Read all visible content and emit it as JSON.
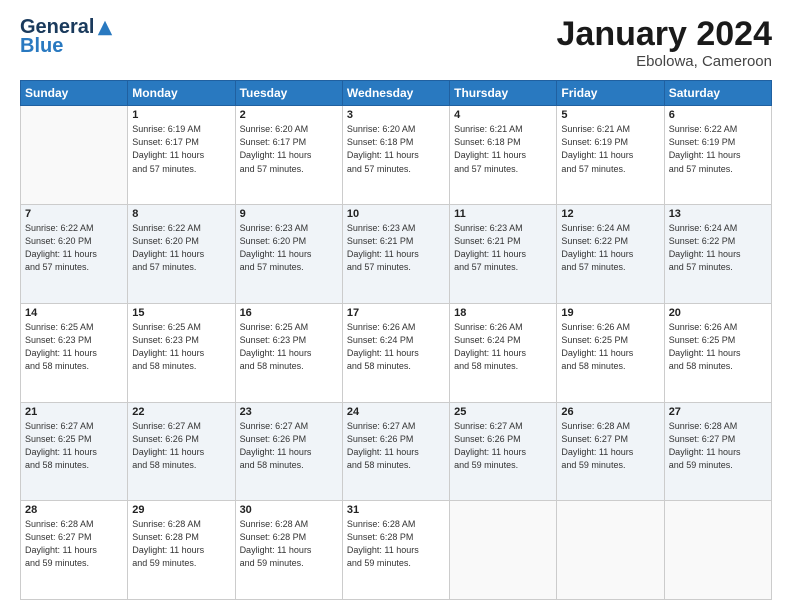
{
  "header": {
    "logo_general": "General",
    "logo_blue": "Blue",
    "month_title": "January 2024",
    "location": "Ebolowa, Cameroon"
  },
  "weekdays": [
    "Sunday",
    "Monday",
    "Tuesday",
    "Wednesday",
    "Thursday",
    "Friday",
    "Saturday"
  ],
  "weeks": [
    [
      {
        "day": "",
        "info": ""
      },
      {
        "day": "1",
        "info": "Sunrise: 6:19 AM\nSunset: 6:17 PM\nDaylight: 11 hours\nand 57 minutes."
      },
      {
        "day": "2",
        "info": "Sunrise: 6:20 AM\nSunset: 6:17 PM\nDaylight: 11 hours\nand 57 minutes."
      },
      {
        "day": "3",
        "info": "Sunrise: 6:20 AM\nSunset: 6:18 PM\nDaylight: 11 hours\nand 57 minutes."
      },
      {
        "day": "4",
        "info": "Sunrise: 6:21 AM\nSunset: 6:18 PM\nDaylight: 11 hours\nand 57 minutes."
      },
      {
        "day": "5",
        "info": "Sunrise: 6:21 AM\nSunset: 6:19 PM\nDaylight: 11 hours\nand 57 minutes."
      },
      {
        "day": "6",
        "info": "Sunrise: 6:22 AM\nSunset: 6:19 PM\nDaylight: 11 hours\nand 57 minutes."
      }
    ],
    [
      {
        "day": "7",
        "info": "Sunrise: 6:22 AM\nSunset: 6:20 PM\nDaylight: 11 hours\nand 57 minutes."
      },
      {
        "day": "8",
        "info": "Sunrise: 6:22 AM\nSunset: 6:20 PM\nDaylight: 11 hours\nand 57 minutes."
      },
      {
        "day": "9",
        "info": "Sunrise: 6:23 AM\nSunset: 6:20 PM\nDaylight: 11 hours\nand 57 minutes."
      },
      {
        "day": "10",
        "info": "Sunrise: 6:23 AM\nSunset: 6:21 PM\nDaylight: 11 hours\nand 57 minutes."
      },
      {
        "day": "11",
        "info": "Sunrise: 6:23 AM\nSunset: 6:21 PM\nDaylight: 11 hours\nand 57 minutes."
      },
      {
        "day": "12",
        "info": "Sunrise: 6:24 AM\nSunset: 6:22 PM\nDaylight: 11 hours\nand 57 minutes."
      },
      {
        "day": "13",
        "info": "Sunrise: 6:24 AM\nSunset: 6:22 PM\nDaylight: 11 hours\nand 57 minutes."
      }
    ],
    [
      {
        "day": "14",
        "info": "Sunrise: 6:25 AM\nSunset: 6:23 PM\nDaylight: 11 hours\nand 58 minutes."
      },
      {
        "day": "15",
        "info": "Sunrise: 6:25 AM\nSunset: 6:23 PM\nDaylight: 11 hours\nand 58 minutes."
      },
      {
        "day": "16",
        "info": "Sunrise: 6:25 AM\nSunset: 6:23 PM\nDaylight: 11 hours\nand 58 minutes."
      },
      {
        "day": "17",
        "info": "Sunrise: 6:26 AM\nSunset: 6:24 PM\nDaylight: 11 hours\nand 58 minutes."
      },
      {
        "day": "18",
        "info": "Sunrise: 6:26 AM\nSunset: 6:24 PM\nDaylight: 11 hours\nand 58 minutes."
      },
      {
        "day": "19",
        "info": "Sunrise: 6:26 AM\nSunset: 6:25 PM\nDaylight: 11 hours\nand 58 minutes."
      },
      {
        "day": "20",
        "info": "Sunrise: 6:26 AM\nSunset: 6:25 PM\nDaylight: 11 hours\nand 58 minutes."
      }
    ],
    [
      {
        "day": "21",
        "info": "Sunrise: 6:27 AM\nSunset: 6:25 PM\nDaylight: 11 hours\nand 58 minutes."
      },
      {
        "day": "22",
        "info": "Sunrise: 6:27 AM\nSunset: 6:26 PM\nDaylight: 11 hours\nand 58 minutes."
      },
      {
        "day": "23",
        "info": "Sunrise: 6:27 AM\nSunset: 6:26 PM\nDaylight: 11 hours\nand 58 minutes."
      },
      {
        "day": "24",
        "info": "Sunrise: 6:27 AM\nSunset: 6:26 PM\nDaylight: 11 hours\nand 58 minutes."
      },
      {
        "day": "25",
        "info": "Sunrise: 6:27 AM\nSunset: 6:26 PM\nDaylight: 11 hours\nand 59 minutes."
      },
      {
        "day": "26",
        "info": "Sunrise: 6:28 AM\nSunset: 6:27 PM\nDaylight: 11 hours\nand 59 minutes."
      },
      {
        "day": "27",
        "info": "Sunrise: 6:28 AM\nSunset: 6:27 PM\nDaylight: 11 hours\nand 59 minutes."
      }
    ],
    [
      {
        "day": "28",
        "info": "Sunrise: 6:28 AM\nSunset: 6:27 PM\nDaylight: 11 hours\nand 59 minutes."
      },
      {
        "day": "29",
        "info": "Sunrise: 6:28 AM\nSunset: 6:28 PM\nDaylight: 11 hours\nand 59 minutes."
      },
      {
        "day": "30",
        "info": "Sunrise: 6:28 AM\nSunset: 6:28 PM\nDaylight: 11 hours\nand 59 minutes."
      },
      {
        "day": "31",
        "info": "Sunrise: 6:28 AM\nSunset: 6:28 PM\nDaylight: 11 hours\nand 59 minutes."
      },
      {
        "day": "",
        "info": ""
      },
      {
        "day": "",
        "info": ""
      },
      {
        "day": "",
        "info": ""
      }
    ]
  ]
}
